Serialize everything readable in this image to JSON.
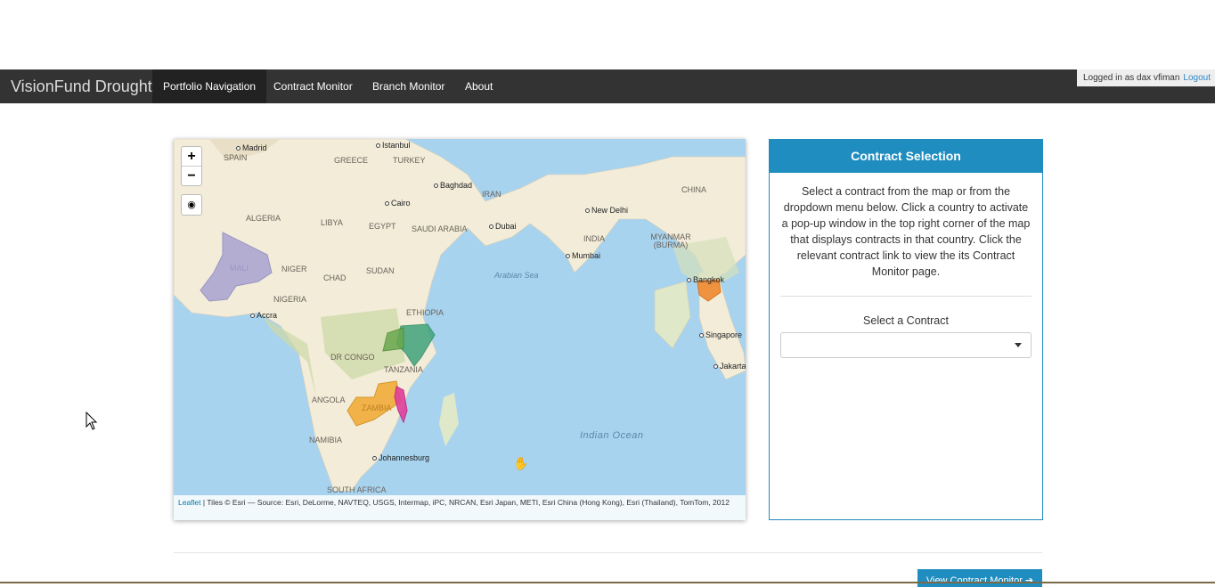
{
  "navbar": {
    "brand": "VisionFund Drought",
    "items": [
      {
        "label": "Portfolio Navigation"
      },
      {
        "label": "Contract Monitor"
      },
      {
        "label": "Branch Monitor"
      },
      {
        "label": "About"
      }
    ],
    "login_text": "Logged in as dax vfiman",
    "logout_label": "Logout"
  },
  "map": {
    "zoom_in": "+",
    "zoom_out": "−",
    "attribution_link": "Leaflet",
    "attribution_text": " | Tiles © Esri — Source: Esri, DeLorme, NAVTEQ, USGS, Intermap, iPC, NRCAN, Esri Japan, METI, Esri China (Hong Kong), Esri (Thailand), TomTom, 2012",
    "countries": [
      "SPAIN",
      "GREECE",
      "TURKEY",
      "IRAN",
      "CHINA",
      "ALGERIA",
      "LIBYA",
      "EGYPT",
      "SAUDI ARABIA",
      "INDIA",
      "MYANMAR (BURMA)",
      "MALI",
      "NIGER",
      "CHAD",
      "SUDAN",
      "NIGERIA",
      "ETHIOPIA",
      "DR CONGO",
      "TANZANIA",
      "ANGOLA",
      "ZAMBIA",
      "NAMIBIA",
      "SOUTH AFRICA"
    ],
    "cities": [
      "Madrid",
      "Istanbul",
      "Baghdad",
      "Cairo",
      "Dubai",
      "New Delhi",
      "Mumbai",
      "Bangkok",
      "Singapore",
      "Jakarta",
      "Accra",
      "Johannesburg"
    ],
    "seas": [
      "Arabian Sea"
    ],
    "oceans": [
      "Indian Ocean"
    ],
    "highlight_colors": {
      "mali": "#a9a4d0",
      "kenya": "#3fa37a",
      "uganda": "#6aa84f",
      "zambia": "#f0a830",
      "malawi": "#e0409a",
      "cambodia": "#f08a30"
    }
  },
  "panel": {
    "title": "Contract Selection",
    "description": "Select a contract from the map or from the dropdown menu below. Click a country to activate a pop-up window in the top right corner of the map that displays contracts in that country. Click the relevant contract link to view the its Contract Monitor page.",
    "select_label": "Select a Contract",
    "select_value": ""
  },
  "footer": {
    "view_button": "View Contract Monitor ➔"
  },
  "colors": {
    "accent": "#1f8dbf",
    "navbar": "#333333",
    "navbar_active": "#222222"
  }
}
